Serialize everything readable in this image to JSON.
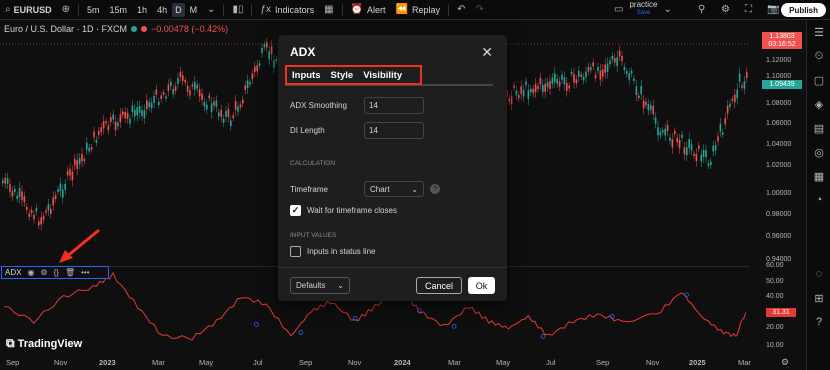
{
  "topbar": {
    "symbol": "EURUSD",
    "intervals": [
      "5m",
      "15m",
      "1h",
      "4h",
      "D",
      "M"
    ],
    "active_interval": "D",
    "indicators_label": "Indicators",
    "alert_label": "Alert",
    "replay_label": "Replay",
    "layout_name": "practice",
    "layout_status": "Save",
    "publish_label": "Publish"
  },
  "legend": {
    "title": "Euro / U.S. Dollar · 1D · FXCM",
    "change": "−0.00478 (−0.42%)"
  },
  "price_axis": {
    "labels": [
      "1.12000",
      "1.10000",
      "1.08000",
      "1.06000",
      "1.04000",
      "1.02000",
      "1.00000",
      "0.98000",
      "0.96000",
      "0.94000"
    ],
    "tag_price": "1.13803",
    "tag_time": "03:16:52",
    "tag_green": "1.09439",
    "adx_labels": [
      "60.00",
      "50.00",
      "40.00",
      "30.00",
      "20.00",
      "10.00"
    ],
    "adx_value": "31.31"
  },
  "adx_pane": {
    "name": "ADX"
  },
  "time_axis": [
    "Sep",
    "Nov",
    "2023",
    "Mar",
    "May",
    "Jul",
    "Sep",
    "Nov",
    "2024",
    "Mar",
    "May",
    "Jul",
    "Sep",
    "Nov",
    "2025",
    "Mar"
  ],
  "brand": "TradingView",
  "dialog": {
    "title": "ADX",
    "tabs": [
      "Inputs",
      "Style",
      "Visibility"
    ],
    "adx_smoothing_label": "ADX Smoothing",
    "adx_smoothing_value": "14",
    "di_length_label": "DI Length",
    "di_length_value": "14",
    "calculation_header": "CALCULATION",
    "timeframe_label": "Timeframe",
    "timeframe_value": "Chart",
    "wait_label": "Wait for timeframe closes",
    "input_values_header": "INPUT VALUES",
    "inputs_status_label": "Inputs in status line",
    "defaults_label": "Defaults",
    "cancel_label": "Cancel",
    "ok_label": "Ok"
  },
  "colors": {
    "up": "#26a69a",
    "down": "#ef5350",
    "accent": "#2962ff",
    "highlight": "#f23020",
    "adx_line": "#e53935"
  }
}
